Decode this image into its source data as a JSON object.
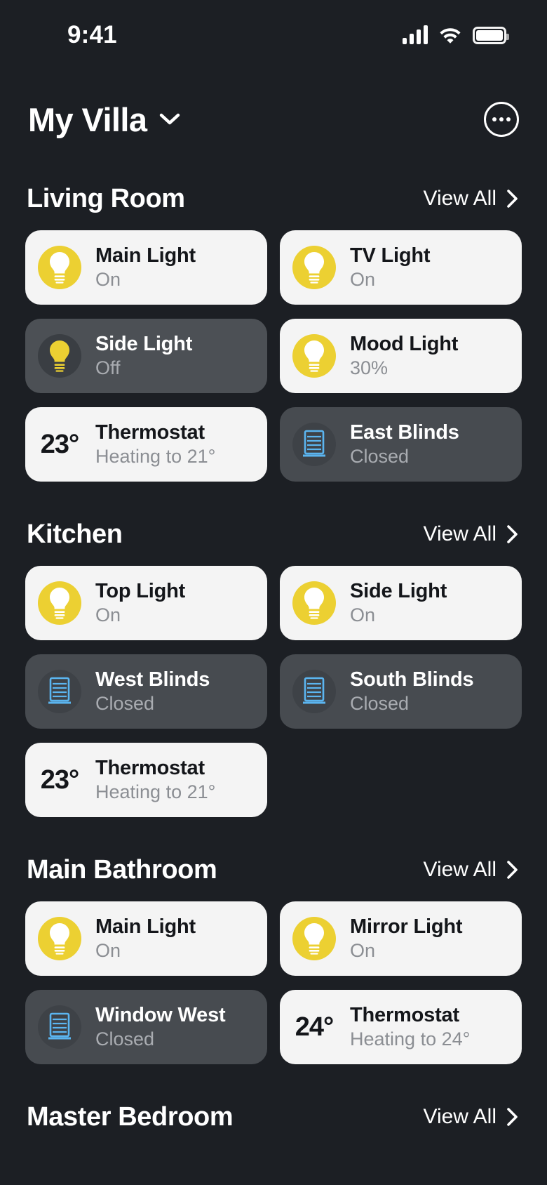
{
  "status_bar": {
    "time": "9:41",
    "signal_icon": "signal-bars-icon",
    "wifi_icon": "wifi-icon",
    "battery_icon": "battery-icon"
  },
  "header": {
    "home_name": "My Villa",
    "home_switcher_icon": "chevron-down-icon",
    "more_options_icon": "more-options-icon"
  },
  "view_all_label": "View All",
  "sections": [
    {
      "title": "Living Room",
      "devices": [
        {
          "name": "Main Light",
          "state": "On",
          "type": "light",
          "status": "on",
          "icon": "light-bulb-icon"
        },
        {
          "name": "TV Light",
          "state": "On",
          "type": "light",
          "status": "on",
          "icon": "light-bulb-icon"
        },
        {
          "name": "Side Light",
          "state": "Off",
          "type": "light",
          "status": "off",
          "icon": "light-bulb-icon"
        },
        {
          "name": "Mood Light",
          "state": "30%",
          "type": "light",
          "status": "on",
          "icon": "light-bulb-icon"
        },
        {
          "name": "Thermostat",
          "state": "Heating to 21°",
          "type": "thermostat",
          "status": "on",
          "temperature": "23°",
          "icon": "thermostat-temperature"
        },
        {
          "name": "East Blinds",
          "state": "Closed",
          "type": "blind",
          "status": "off",
          "icon": "blinds-icon"
        }
      ]
    },
    {
      "title": "Kitchen",
      "devices": [
        {
          "name": "Top Light",
          "state": "On",
          "type": "light",
          "status": "on",
          "icon": "light-bulb-icon"
        },
        {
          "name": "Side Light",
          "state": "On",
          "type": "light",
          "status": "on",
          "icon": "light-bulb-icon"
        },
        {
          "name": "West Blinds",
          "state": "Closed",
          "type": "blind",
          "status": "off",
          "icon": "blinds-icon"
        },
        {
          "name": "South Blinds",
          "state": "Closed",
          "type": "blind",
          "status": "off",
          "icon": "blinds-icon"
        },
        {
          "name": "Thermostat",
          "state": "Heating to 21°",
          "type": "thermostat",
          "status": "on",
          "temperature": "23°",
          "icon": "thermostat-temperature"
        }
      ]
    },
    {
      "title": "Main Bathroom",
      "devices": [
        {
          "name": "Main Light",
          "state": "On",
          "type": "light",
          "status": "on",
          "icon": "light-bulb-icon"
        },
        {
          "name": "Mirror Light",
          "state": "On",
          "type": "light",
          "status": "on",
          "icon": "light-bulb-icon"
        },
        {
          "name": "Window West",
          "state": "Closed",
          "type": "blind",
          "status": "off",
          "icon": "blinds-icon"
        },
        {
          "name": "Thermostat",
          "state": "Heating to 24°",
          "type": "thermostat",
          "status": "on",
          "temperature": "24°",
          "icon": "thermostat-temperature"
        }
      ]
    },
    {
      "title": "Master Bedroom",
      "devices": []
    }
  ],
  "colors": {
    "background": "#1c1f24",
    "card_on": "#f4f4f4",
    "card_off": "#4c5055",
    "bulb_yellow": "#ecd032",
    "blind_blue": "#5bb5f0",
    "text_primary_dark": "#14161a",
    "text_secondary_dark": "#8b8e93",
    "text_primary_light": "#ffffff",
    "text_secondary_light": "#a9acb1"
  }
}
